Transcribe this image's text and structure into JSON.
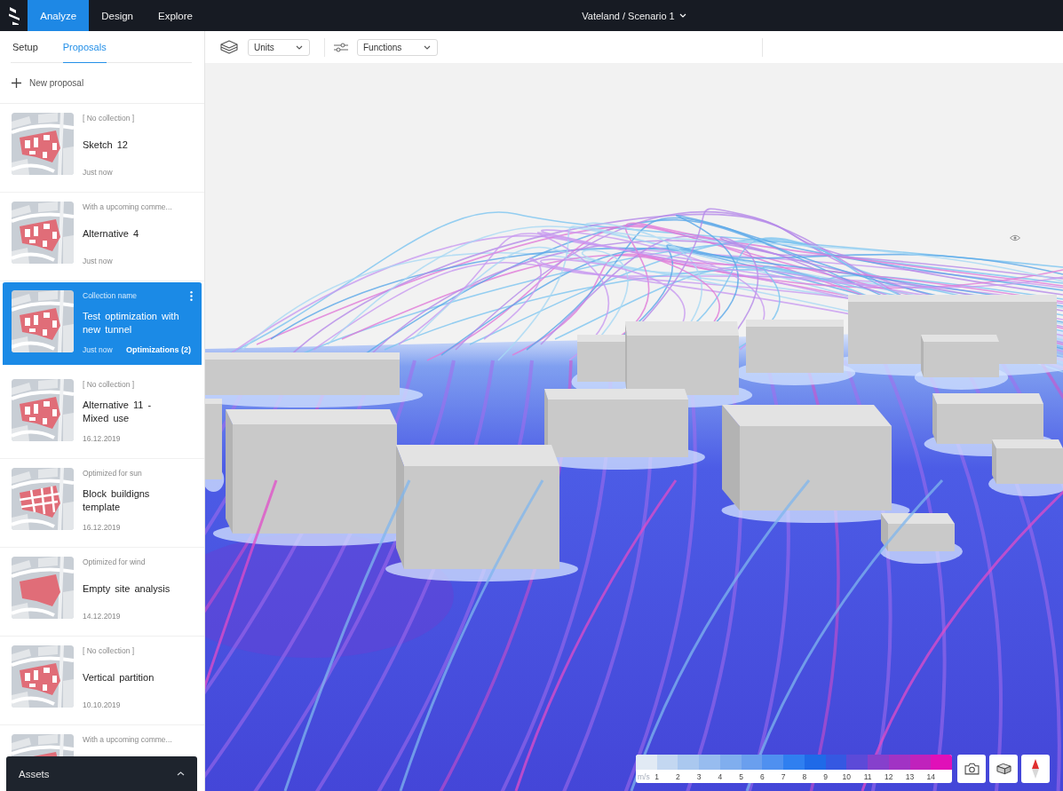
{
  "topbar": {
    "tabs": [
      {
        "label": "Analyze",
        "selected": true
      },
      {
        "label": "Design",
        "selected": false
      },
      {
        "label": "Explore",
        "selected": false
      }
    ],
    "title": "Vateland / Scenario 1"
  },
  "sidebar": {
    "tabs": [
      {
        "label": "Setup",
        "selected": false
      },
      {
        "label": "Proposals",
        "selected": true
      }
    ],
    "new_proposal": "New proposal",
    "proposals": [
      {
        "kind": "buildings",
        "collection": "[ No collection ]",
        "name": "Sketch 12",
        "date": "Just now",
        "selected": false
      },
      {
        "kind": "buildings",
        "collection": "With a upcoming comme...",
        "name": "Alternative 4",
        "date": "Just now",
        "selected": false
      },
      {
        "kind": "buildings",
        "collection": "Collection name",
        "name": "Test optimization with new tunnel",
        "date": "Just now",
        "optimizations": "Optimizations (2)",
        "selected": true
      },
      {
        "kind": "buildings",
        "collection": "[ No collection ]",
        "name": "Alternative 11 - Mixed use",
        "date": "16.12.2019",
        "selected": false
      },
      {
        "kind": "blocks",
        "collection": "Optimized for sun",
        "name": "Block buildigns template",
        "date": "16.12.2019",
        "selected": false
      },
      {
        "kind": "solid",
        "collection": "Optimized for wind",
        "name": "Empty site analysis",
        "date": "14.12.2019",
        "selected": false
      },
      {
        "kind": "buildings",
        "collection": "[ No collection ]",
        "name": "Vertical partition",
        "date": "10.10.2019",
        "selected": false
      },
      {
        "kind": "buildings",
        "collection": "With a upcoming comme...",
        "selected": false
      }
    ],
    "assets": {
      "label": "Assets",
      "expanded": false
    }
  },
  "toolbar": {
    "units": "Units",
    "functions": "Functions"
  },
  "legend": {
    "unit": "m/s",
    "ticks": [
      "1",
      "2",
      "3",
      "4",
      "5",
      "6",
      "7",
      "8",
      "9",
      "10",
      "11",
      "12",
      "13",
      "14"
    ],
    "swatches": [
      {
        "color": "#e1eaf4"
      },
      {
        "color": "#c3d7f1"
      },
      {
        "color": "#aac8ef"
      },
      {
        "color": "#97bcef"
      },
      {
        "color": "#80aeee"
      },
      {
        "color": "#6a9fee"
      },
      {
        "color": "#4f90f0"
      },
      {
        "color": "#2f7ff0"
      },
      {
        "color": "#1f6ae8"
      },
      {
        "color": "#3558e2"
      },
      {
        "color": "#5c4ad8"
      },
      {
        "color": "#8640cc"
      },
      {
        "color": "#a133c4"
      },
      {
        "color": "#c022bc"
      },
      {
        "color": "#e010b8"
      }
    ]
  }
}
